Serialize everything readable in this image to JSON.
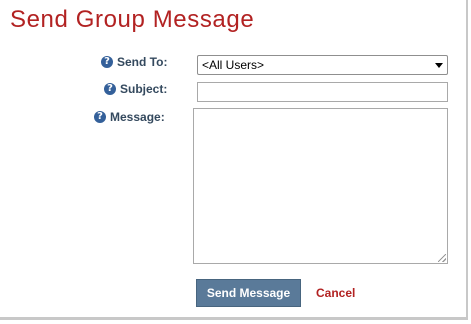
{
  "page": {
    "title": "Send Group Message"
  },
  "form": {
    "help_icon_name": "question-circle-icon",
    "help_glyph": "?",
    "send_to": {
      "label": "Send To:",
      "selected": "<All Users>"
    },
    "subject": {
      "label": "Subject:",
      "value": ""
    },
    "message": {
      "label": "Message:",
      "value": ""
    }
  },
  "actions": {
    "send_label": "Send Message",
    "cancel_label": "Cancel"
  },
  "colors": {
    "title": "#b22222",
    "label": "#34495e",
    "button_bg": "#5a7a99",
    "cancel": "#b22222"
  }
}
